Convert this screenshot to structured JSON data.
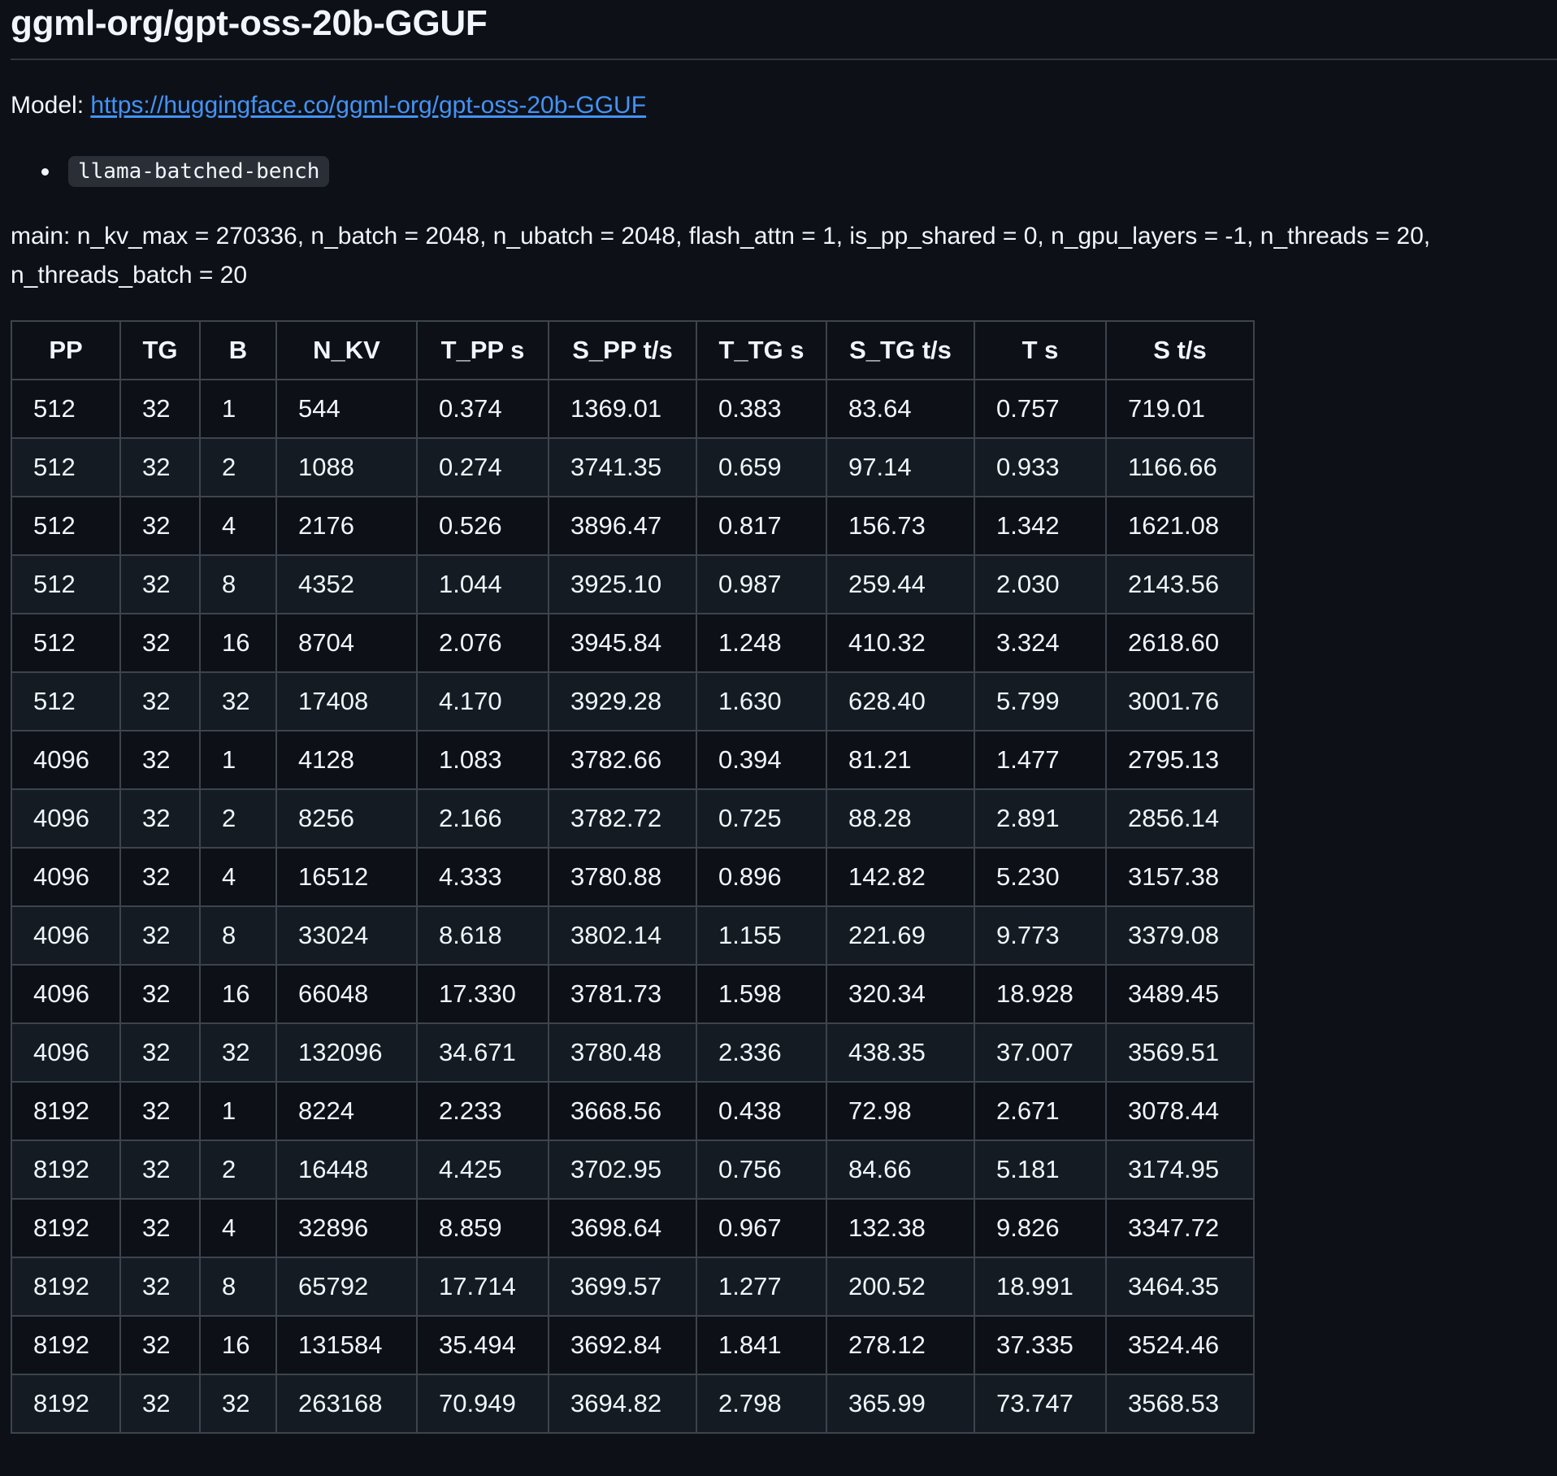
{
  "heading": "ggml-org/gpt-oss-20b-GGUF",
  "model": {
    "label": "Model: ",
    "link_text": "https://huggingface.co/ggml-org/gpt-oss-20b-GGUF"
  },
  "bullet": {
    "code": "llama-batched-bench"
  },
  "main_text": "main: n_kv_max = 270336, n_batch = 2048, n_ubatch = 2048, flash_attn = 1, is_pp_shared = 0, n_gpu_layers = -1, n_threads = 20, n_threads_batch = 20",
  "table": {
    "headers": [
      "PP",
      "TG",
      "B",
      "N_KV",
      "T_PP s",
      "S_PP t/s",
      "T_TG s",
      "S_TG t/s",
      "T s",
      "S t/s"
    ],
    "rows": [
      [
        "512",
        "32",
        "1",
        "544",
        "0.374",
        "1369.01",
        "0.383",
        "83.64",
        "0.757",
        "719.01"
      ],
      [
        "512",
        "32",
        "2",
        "1088",
        "0.274",
        "3741.35",
        "0.659",
        "97.14",
        "0.933",
        "1166.66"
      ],
      [
        "512",
        "32",
        "4",
        "2176",
        "0.526",
        "3896.47",
        "0.817",
        "156.73",
        "1.342",
        "1621.08"
      ],
      [
        "512",
        "32",
        "8",
        "4352",
        "1.044",
        "3925.10",
        "0.987",
        "259.44",
        "2.030",
        "2143.56"
      ],
      [
        "512",
        "32",
        "16",
        "8704",
        "2.076",
        "3945.84",
        "1.248",
        "410.32",
        "3.324",
        "2618.60"
      ],
      [
        "512",
        "32",
        "32",
        "17408",
        "4.170",
        "3929.28",
        "1.630",
        "628.40",
        "5.799",
        "3001.76"
      ],
      [
        "4096",
        "32",
        "1",
        "4128",
        "1.083",
        "3782.66",
        "0.394",
        "81.21",
        "1.477",
        "2795.13"
      ],
      [
        "4096",
        "32",
        "2",
        "8256",
        "2.166",
        "3782.72",
        "0.725",
        "88.28",
        "2.891",
        "2856.14"
      ],
      [
        "4096",
        "32",
        "4",
        "16512",
        "4.333",
        "3780.88",
        "0.896",
        "142.82",
        "5.230",
        "3157.38"
      ],
      [
        "4096",
        "32",
        "8",
        "33024",
        "8.618",
        "3802.14",
        "1.155",
        "221.69",
        "9.773",
        "3379.08"
      ],
      [
        "4096",
        "32",
        "16",
        "66048",
        "17.330",
        "3781.73",
        "1.598",
        "320.34",
        "18.928",
        "3489.45"
      ],
      [
        "4096",
        "32",
        "32",
        "132096",
        "34.671",
        "3780.48",
        "2.336",
        "438.35",
        "37.007",
        "3569.51"
      ],
      [
        "8192",
        "32",
        "1",
        "8224",
        "2.233",
        "3668.56",
        "0.438",
        "72.98",
        "2.671",
        "3078.44"
      ],
      [
        "8192",
        "32",
        "2",
        "16448",
        "4.425",
        "3702.95",
        "0.756",
        "84.66",
        "5.181",
        "3174.95"
      ],
      [
        "8192",
        "32",
        "4",
        "32896",
        "8.859",
        "3698.64",
        "0.967",
        "132.38",
        "9.826",
        "3347.72"
      ],
      [
        "8192",
        "32",
        "8",
        "65792",
        "17.714",
        "3699.57",
        "1.277",
        "200.52",
        "18.991",
        "3464.35"
      ],
      [
        "8192",
        "32",
        "16",
        "131584",
        "35.494",
        "3692.84",
        "1.841",
        "278.12",
        "37.335",
        "3524.46"
      ],
      [
        "8192",
        "32",
        "32",
        "263168",
        "70.949",
        "3694.82",
        "2.798",
        "365.99",
        "73.747",
        "3568.53"
      ]
    ]
  }
}
